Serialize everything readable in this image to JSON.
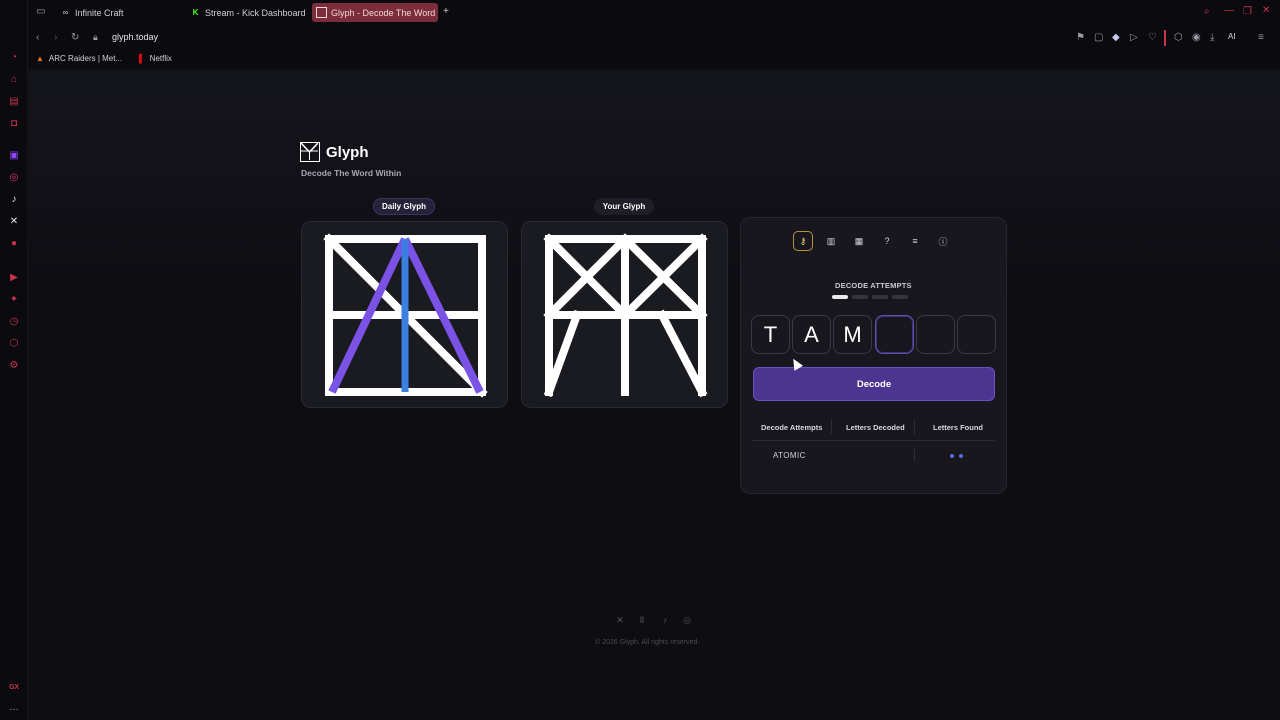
{
  "browser": {
    "tabs": [
      {
        "label": "Infinite Craft",
        "icon": "infinity-icon"
      },
      {
        "label": "Stream - Kick Dashboard",
        "icon": "kick-k-icon"
      },
      {
        "label": "Glyph - Decode The Word",
        "icon": "glyph-logo-icon"
      }
    ],
    "url": "glyph.today",
    "ai_label": "AI",
    "bookmarks": [
      {
        "label": "ARC Raiders | Met...",
        "icon": "arc-raiders-icon"
      },
      {
        "label": "Netflix",
        "icon": "netflix-icon"
      }
    ],
    "sidebar_gx": "GX",
    "colors": {
      "accent": "#c8334d",
      "active_tab": "#7c2d3c"
    }
  },
  "app": {
    "title": "Glyph",
    "subtitle": "Decode The Word Within",
    "daily_label": "Daily Glyph",
    "your_label": "Your Glyph",
    "attempts_heading": "DECODE ATTEMPTS",
    "attempts_used": 1,
    "attempts_total": 4,
    "letters": [
      "T",
      "A",
      "M",
      "",
      "",
      ""
    ],
    "decode_button": "Decode",
    "table_headers": [
      "Decode Attempts",
      "Letters Decoded",
      "Letters Found"
    ],
    "history": [
      {
        "word": "ATOMIC",
        "decoded": "",
        "found_dots": 2
      }
    ],
    "copyright": "© 2026 Glyph. All rights reserved.",
    "colors": {
      "primary": "#4b3591",
      "blue": "#3b7fe0",
      "violet": "#7b52e6"
    }
  }
}
